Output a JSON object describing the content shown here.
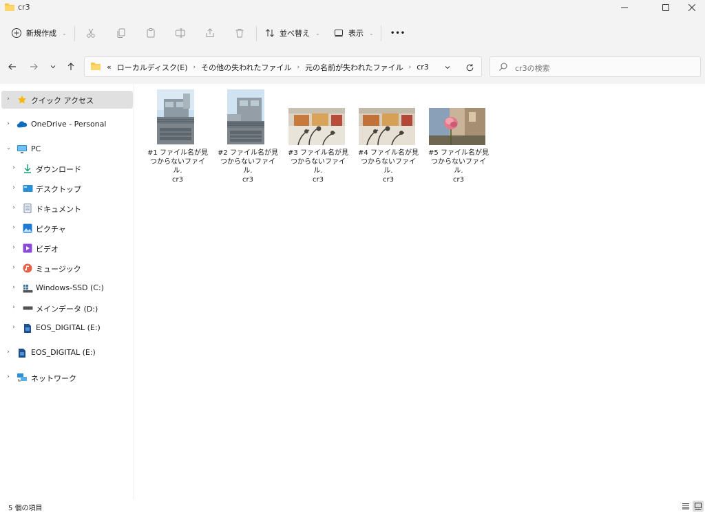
{
  "window": {
    "title": "cr3",
    "controls": [
      "minimize",
      "maximize",
      "close"
    ]
  },
  "commandbar": {
    "new_label": "新規作成",
    "sort_label": "並べ替え",
    "view_label": "表示",
    "more_label": "•••",
    "icons": [
      "cut-icon",
      "copy-icon",
      "paste-icon",
      "rename-icon",
      "share-icon",
      "delete-icon"
    ]
  },
  "address": {
    "overflow": "«",
    "crumbs": [
      "ローカルディスク(E)",
      "その他の失われたファイル",
      "元の名前が失われたファイル",
      "cr3"
    ]
  },
  "search": {
    "placeholder": "cr3の検索"
  },
  "sidebar": {
    "items": [
      {
        "label": "クイック アクセス",
        "icon": "star-icon",
        "color": "#f6b700"
      },
      {
        "label": "OneDrive - Personal",
        "icon": "cloud-icon",
        "color": "#0f6cbd"
      },
      {
        "label": "PC",
        "icon": "monitor-icon",
        "color": "#2f8fd8"
      },
      {
        "label": "ダウンロード",
        "icon": "download-icon",
        "color": "#1c9f6e"
      },
      {
        "label": "デスクトップ",
        "icon": "desktop-icon",
        "color": "#2b8fd8"
      },
      {
        "label": "ドキュメント",
        "icon": "document-icon",
        "color": "#7c8ea6"
      },
      {
        "label": "ピクチャ",
        "icon": "pictures-icon",
        "color": "#1f7ad6"
      },
      {
        "label": "ビデオ",
        "icon": "video-icon",
        "color": "#8a4bd6"
      },
      {
        "label": "ミュージック",
        "icon": "music-icon",
        "color": "#e2624b"
      },
      {
        "label": "Windows-SSD (C:)",
        "icon": "windows-drive-icon",
        "color": "#3c6fb0"
      },
      {
        "label": "メインデータ (D:)",
        "icon": "drive-icon",
        "color": "#555555"
      },
      {
        "label": "EOS_DIGITAL (E:)",
        "icon": "sdcard-icon",
        "color": "#1e4f8c"
      },
      {
        "label": "EOS_DIGITAL (E:)",
        "icon": "sdcard-icon",
        "color": "#1e4f8c"
      },
      {
        "label": "ネットワーク",
        "icon": "network-icon",
        "color": "#2b8fd8"
      }
    ]
  },
  "files": [
    {
      "line1": "#1 ファイル名が見",
      "line2": "つからないファイル.",
      "line3": "cr3",
      "thumb": "building"
    },
    {
      "line1": "#2 ファイル名が見",
      "line2": "つからないファイル.",
      "line3": "cr3",
      "thumb": "building"
    },
    {
      "line1": "#3 ファイル名が見",
      "line2": "つからないファイル.",
      "line3": "cr3",
      "thumb": "wall"
    },
    {
      "line1": "#4 ファイル名が見",
      "line2": "つからないファイル.",
      "line3": "cr3",
      "thumb": "wall"
    },
    {
      "line1": "#5 ファイル名が見",
      "line2": "つからないファイル.",
      "line3": "cr3",
      "thumb": "rose"
    }
  ],
  "status": {
    "count": "5 個の項目"
  },
  "colors": {
    "accent": "#005fb8",
    "chrome": "#f3f3f3",
    "selection": "#e0e0e0"
  }
}
